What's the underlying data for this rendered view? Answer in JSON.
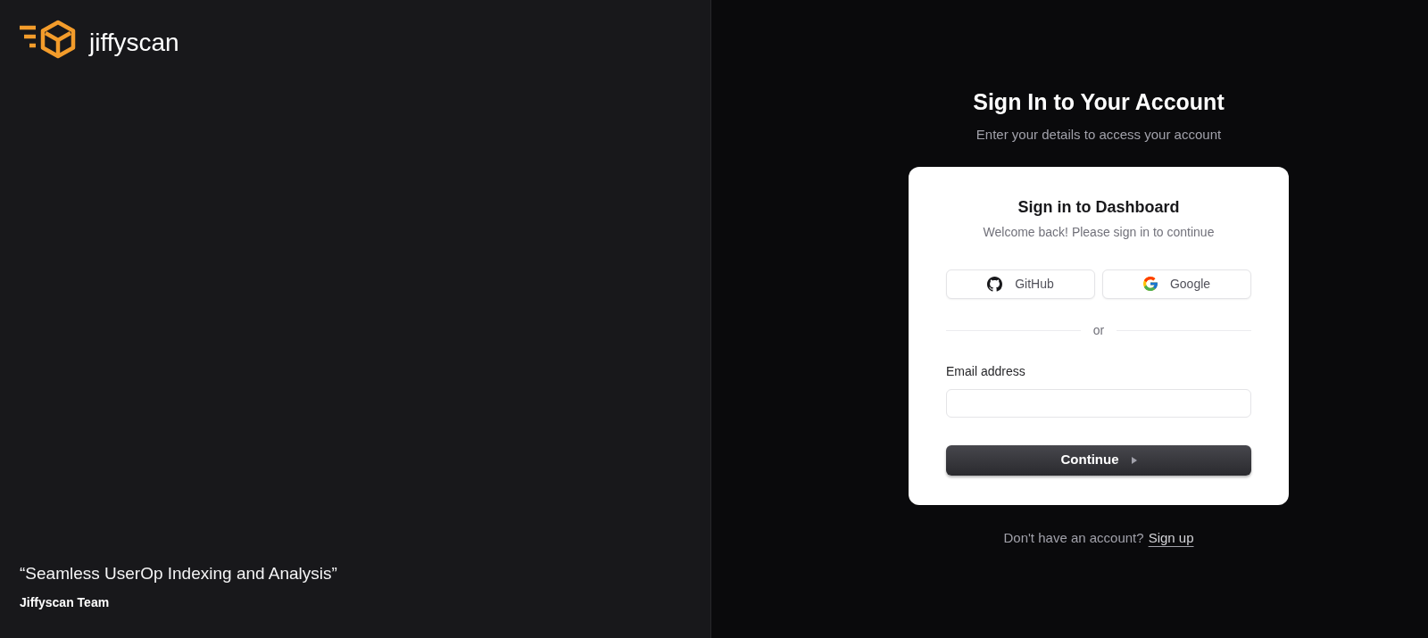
{
  "brand": {
    "name": "jiffyscan"
  },
  "quote": {
    "text": "“Seamless UserOp Indexing and Analysis”",
    "author": "Jiffyscan Team"
  },
  "header": {
    "title": "Sign In to Your Account",
    "subtitle": "Enter your details to access your account"
  },
  "card": {
    "title": "Sign in to Dashboard",
    "subtitle": "Welcome back! Please sign in to continue",
    "social_buttons": [
      {
        "kind": "github",
        "label": "GitHub"
      },
      {
        "kind": "google",
        "label": "Google"
      }
    ],
    "divider": "or",
    "email": {
      "label": "Email address"
    },
    "submit": {
      "label": "Continue"
    }
  },
  "footer": {
    "text": "Don't have an account?",
    "link": "Sign up"
  }
}
